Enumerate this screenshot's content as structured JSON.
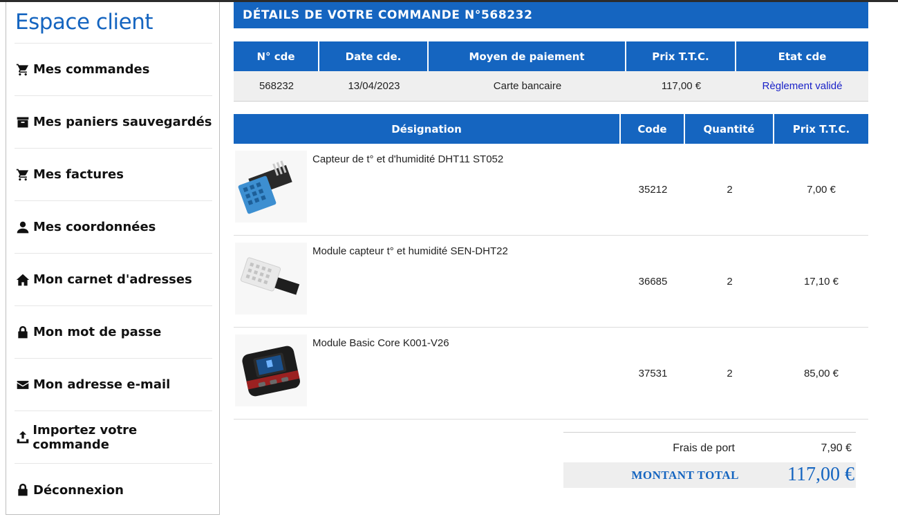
{
  "sidebar": {
    "title": "Espace client",
    "items": [
      {
        "label": "Mes commandes",
        "icon": "cart-icon"
      },
      {
        "label": "Mes paniers sauvegardés",
        "icon": "archive-box-icon"
      },
      {
        "label": "Mes factures",
        "icon": "cart-icon"
      },
      {
        "label": "Mes coordonnées",
        "icon": "user-icon"
      },
      {
        "label": "Mon carnet d'adresses",
        "icon": "home-icon"
      },
      {
        "label": "Mon mot de passe",
        "icon": "lock-icon"
      },
      {
        "label": "Mon adresse e-mail",
        "icon": "envelope-icon"
      },
      {
        "label": "Importez votre commande",
        "icon": "upload-icon"
      },
      {
        "label": "Déconnexion",
        "icon": "lock-icon"
      }
    ]
  },
  "header": {
    "title": "DÉTAILS DE VOTRE COMMANDE N°568232"
  },
  "order": {
    "columns": [
      "N° cde",
      "Date cde.",
      "Moyen de paiement",
      "Prix T.T.C.",
      "Etat cde"
    ],
    "number": "568232",
    "date": "13/04/2023",
    "payment": "Carte bancaire",
    "price": "117,00 €",
    "status": "Règlement validé"
  },
  "items": {
    "columns": [
      "Désignation",
      "Code",
      "Quantité",
      "Prix T.T.C."
    ],
    "rows": [
      {
        "name": "Capteur de t° et d'humidité DHT11 ST052",
        "code": "35212",
        "qty": "2",
        "price": "7,00 €",
        "image": "dht11-sensor-image"
      },
      {
        "name": "Module capteur t° et humidité SEN-DHT22",
        "code": "36685",
        "qty": "2",
        "price": "17,10 €",
        "image": "dht22-sensor-image"
      },
      {
        "name": "Module Basic Core K001-V26",
        "code": "37531",
        "qty": "2",
        "price": "85,00 €",
        "image": "basic-core-module-image"
      }
    ]
  },
  "totals": {
    "shipping_label": "Frais de port",
    "shipping_value": "7,90 €",
    "total_label": "MONTANT TOTAL",
    "total_value": "117,00 €"
  },
  "colors": {
    "accent": "#1565c0",
    "status_link": "#1a22c8",
    "row_bg": "#efefef"
  }
}
